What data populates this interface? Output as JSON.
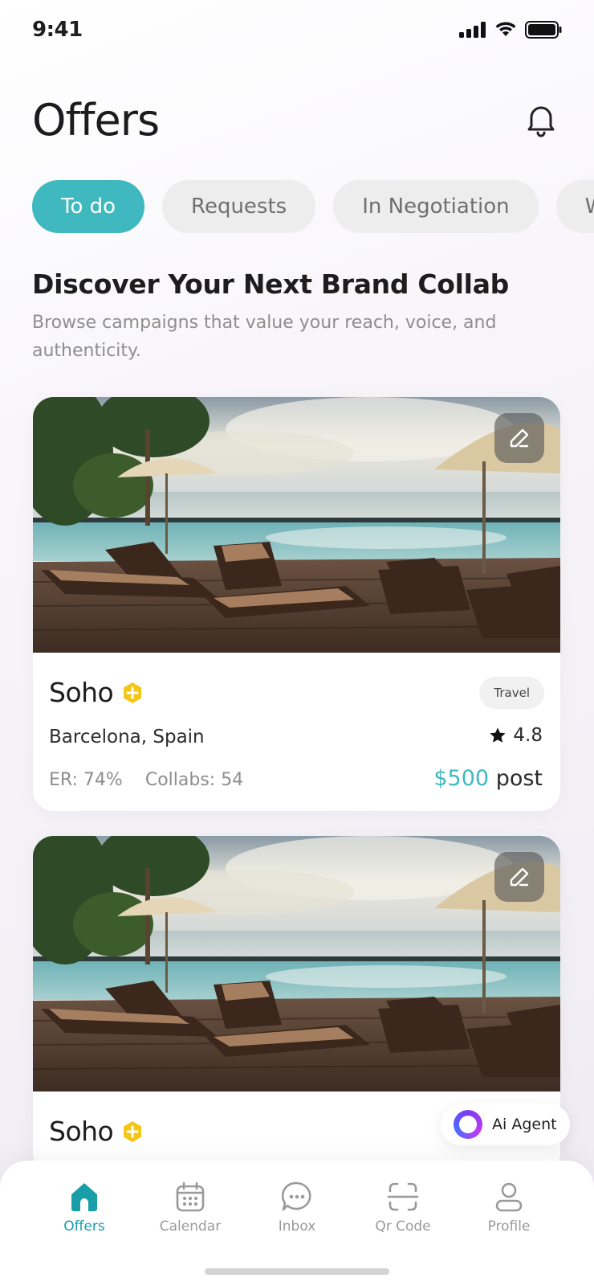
{
  "status_bar": {
    "time": "9:41"
  },
  "header": {
    "title": "Offers"
  },
  "tabs": [
    {
      "label": "To do",
      "active": true
    },
    {
      "label": "Requests",
      "active": false
    },
    {
      "label": "In Negotiation",
      "active": false
    },
    {
      "label": "Wo",
      "active": false
    }
  ],
  "discover": {
    "title": "Discover Your Next Brand Collab",
    "subtitle": "Browse campaigns that value your reach, voice, and authenticity."
  },
  "cards": [
    {
      "brand": "Soho",
      "category": "Travel",
      "location": "Barcelona, Spain",
      "rating": "4.8",
      "er": "ER: 74%",
      "collabs": "Collabs: 54",
      "price_amount": "$500",
      "price_unit": "post"
    },
    {
      "brand": "Soho"
    }
  ],
  "ai_agent": {
    "label": "Ai Agent"
  },
  "tabbar": [
    {
      "label": "Offers",
      "icon": "home-icon",
      "active": true
    },
    {
      "label": "Calendar",
      "icon": "calendar-icon",
      "active": false
    },
    {
      "label": "Inbox",
      "icon": "chat-icon",
      "active": false
    },
    {
      "label": "Qr Code",
      "icon": "qr-scan-icon",
      "active": false
    },
    {
      "label": "Profile",
      "icon": "user-icon",
      "active": false
    }
  ],
  "colors": {
    "accent": "#3fb8c0",
    "accent_dark": "#199ea8",
    "verified": "#f5c518"
  }
}
